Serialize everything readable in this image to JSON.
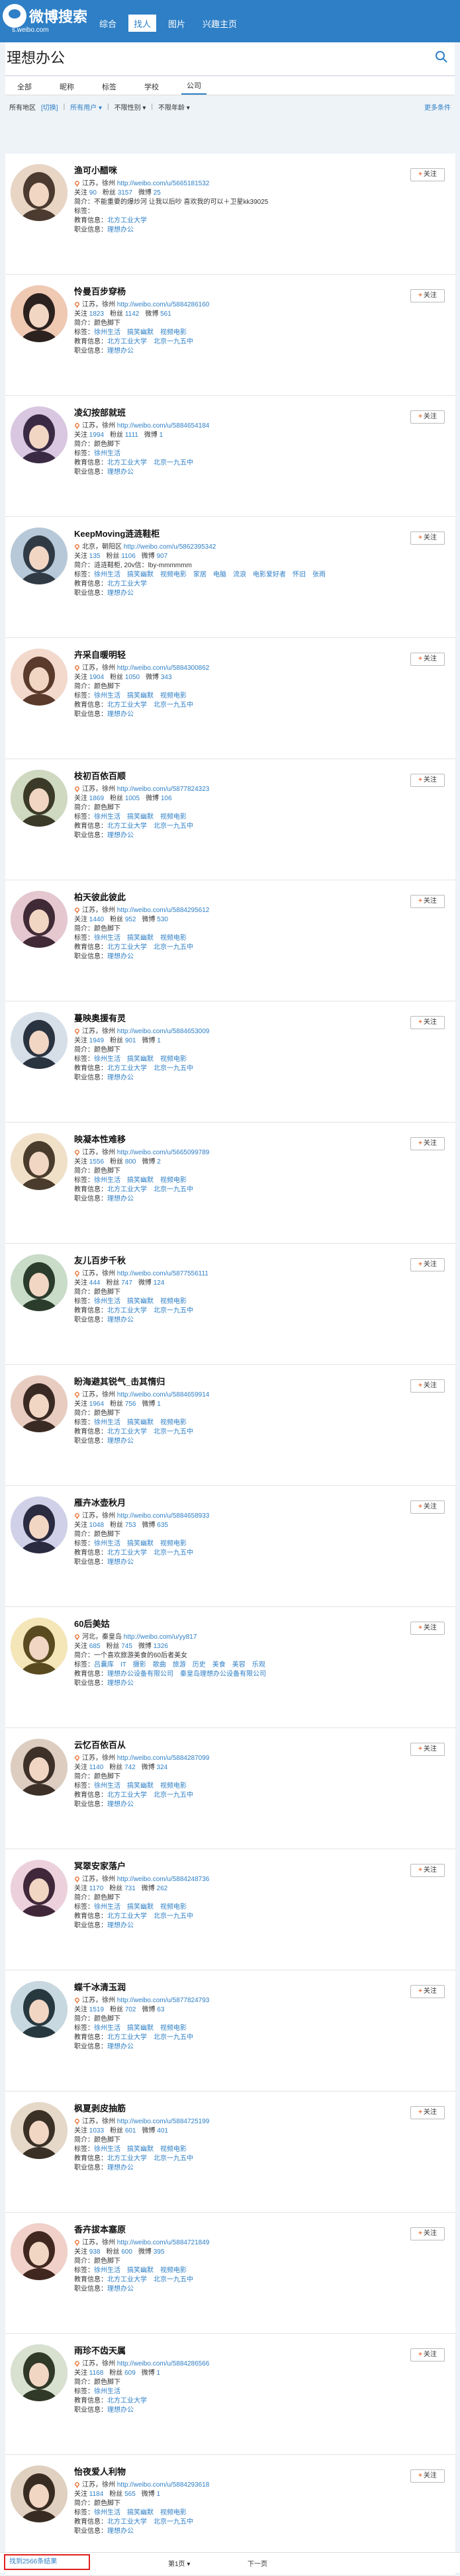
{
  "header": {
    "logo_text": "微博搜索",
    "logo_sub": "s.weibo.com",
    "nav": [
      {
        "label": "综合",
        "active": false
      },
      {
        "label": "找人",
        "active": true
      },
      {
        "label": "图片",
        "active": false
      },
      {
        "label": "兴趣主页",
        "active": false
      }
    ]
  },
  "search": {
    "query": "理想办公"
  },
  "tabs": [
    {
      "label": "全部",
      "active": false
    },
    {
      "label": "昵称",
      "active": false
    },
    {
      "label": "标签",
      "active": false
    },
    {
      "label": "学校",
      "active": false
    },
    {
      "label": "公司",
      "active": true
    }
  ],
  "filter": {
    "region_label": "所有地区",
    "region_link": "[切换]",
    "user_type": "所有用户 ▾",
    "gender": "不限性别 ▾",
    "age": "不限年龄 ▾",
    "more": "更多条件"
  },
  "labels": {
    "follow": "关注",
    "follows": "关注",
    "fans": "粉丝",
    "weibo": "微博",
    "intro": "简介：",
    "tags": "标签：",
    "edu": "教育信息：",
    "job": "职业信息："
  },
  "users": [
    {
      "name": "渔可小醋咪",
      "location": "江苏，徐州",
      "url": "http://weibo.com/u/5665181532",
      "follows": "90",
      "fans": "3157",
      "weibo": "25",
      "intro": "不能重要的爆炒河 让我以后吵 喜欢我的可以＋卫星kk39025",
      "tags": "",
      "edu": "北方工业大学",
      "job": "理想办公"
    },
    {
      "name": "怜曼百步穿杨",
      "location": "江苏，徐州",
      "url": "http://weibo.com/u/5884286160",
      "follows": "1823",
      "fans": "1142",
      "weibo": "561",
      "intro": "颜色脚下",
      "tags": "徐州生活　搞笑幽默　视频电影",
      "edu": "北方工业大学　北京一九五中",
      "job": "理想办公"
    },
    {
      "name": "凌幻按部就班",
      "location": "江苏，徐州",
      "url": "http://weibo.com/u/5884654184",
      "follows": "1994",
      "fans": "1111",
      "weibo": "1",
      "intro": "颜色脚下",
      "tags": "徐州生活",
      "edu": "北方工业大学　北京一九五中",
      "job": "理想办公"
    },
    {
      "name": "KeepMoving涟涟鞋柜",
      "location": "北京，朝阳区",
      "url": "http://weibo.com/u/5862395342",
      "follows": "135",
      "fans": "1106",
      "weibo": "907",
      "intro": "涟涟鞋柜, 20v信：lby-mmmmmm",
      "tags": "徐州生活　搞笑幽默　视频电影　家居　电脑　流浪　电影爱好者　怀旧　张雨",
      "edu": "北方工业大学",
      "job": "理想办公"
    },
    {
      "name": "卉采自暖明轻",
      "location": "江苏，徐州",
      "url": "http://weibo.com/u/5884300862",
      "follows": "1904",
      "fans": "1050",
      "weibo": "343",
      "intro": "颜色脚下",
      "tags": "徐州生活　搞笑幽默　视频电影",
      "edu": "北方工业大学　北京一九五中",
      "job": "理想办公"
    },
    {
      "name": "枝初百依百顺",
      "location": "江苏，徐州",
      "url": "http://weibo.com/u/5877824323",
      "follows": "1869",
      "fans": "1005",
      "weibo": "106",
      "intro": "颜色脚下",
      "tags": "徐州生活　搞笑幽默　视频电影",
      "edu": "北方工业大学　北京一九五中",
      "job": "理想办公"
    },
    {
      "name": "柏天彼此彼此",
      "location": "江苏，徐州",
      "url": "http://weibo.com/u/5884295612",
      "follows": "1440",
      "fans": "952",
      "weibo": "530",
      "intro": "颜色脚下",
      "tags": "徐州生活　搞笑幽默　视频电影",
      "edu": "北方工业大学　北京一九五中",
      "job": "理想办公"
    },
    {
      "name": "蔓映奥援有灵",
      "location": "江苏，徐州",
      "url": "http://weibo.com/u/5884653009",
      "follows": "1949",
      "fans": "901",
      "weibo": "1",
      "intro": "颜色脚下",
      "tags": "徐州生活　搞笑幽默　视频电影",
      "edu": "北方工业大学　北京一九五中",
      "job": "理想办公"
    },
    {
      "name": "映凝本性难移",
      "location": "江苏，徐州",
      "url": "http://weibo.com/u/5665099789",
      "follows": "1556",
      "fans": "800",
      "weibo": "2",
      "intro": "颜色脚下",
      "tags": "徐州生活　搞笑幽默　视频电影",
      "edu": "北方工业大学　北京一九五中",
      "job": "理想办公"
    },
    {
      "name": "友儿百步千秋",
      "location": "江苏，徐州",
      "url": "http://weibo.com/u/5877556111",
      "follows": "444",
      "fans": "747",
      "weibo": "124",
      "intro": "颜色脚下",
      "tags": "徐州生活　搞笑幽默　视频电影",
      "edu": "北方工业大学　北京一九五中",
      "job": "理想办公"
    },
    {
      "name": "盼海避其锐气_击其惰归",
      "location": "江苏，徐州",
      "url": "http://weibo.com/u/5884659914",
      "follows": "1964",
      "fans": "756",
      "weibo": "1",
      "intro": "颜色脚下",
      "tags": "徐州生活　搞笑幽默　视频电影",
      "edu": "北方工业大学　北京一九五中",
      "job": "理想办公"
    },
    {
      "name": "雁卉冰壶秋月",
      "location": "江苏，徐州",
      "url": "http://weibo.com/u/5884658933",
      "follows": "1048",
      "fans": "753",
      "weibo": "635",
      "intro": "颜色脚下",
      "tags": "徐州生活　搞笑幽默　视频电影",
      "edu": "北方工业大学　北京一九五中",
      "job": "理想办公"
    },
    {
      "name": "60后美姑",
      "location": "河北，秦皇岛",
      "url": "http://weibo.com/u/yy817",
      "follows": "685",
      "fans": "745",
      "weibo": "1326",
      "intro": "一个喜欢旅游美食的60后者美女",
      "tags": "吕囊库　IT　摄影　歌曲　旅游　历史　美食　美容　乐观",
      "edu": "理想办公设备有限公司　秦皇岛理想办公设备有限公司",
      "job": "理想办公"
    },
    {
      "name": "云忆百依百从",
      "location": "江苏，徐州",
      "url": "http://weibo.com/u/5884287099",
      "follows": "1140",
      "fans": "742",
      "weibo": "324",
      "intro": "颜色脚下",
      "tags": "徐州生活　搞笑幽默　视频电影",
      "edu": "北方工业大学　北京一九五中",
      "job": "理想办公"
    },
    {
      "name": "冥翠安家落户",
      "location": "江苏，徐州",
      "url": "http://weibo.com/u/5884248736",
      "follows": "1170",
      "fans": "731",
      "weibo": "262",
      "intro": "颜色脚下",
      "tags": "徐州生活　搞笑幽默　视频电影",
      "edu": "北方工业大学　北京一九五中",
      "job": "理想办公"
    },
    {
      "name": "蝶千冰清玉润",
      "location": "江苏，徐州",
      "url": "http://weibo.com/u/5877824793",
      "follows": "1519",
      "fans": "702",
      "weibo": "63",
      "intro": "颜色脚下",
      "tags": "徐州生活　搞笑幽默　视频电影",
      "edu": "北方工业大学　北京一九五中",
      "job": "理想办公"
    },
    {
      "name": "枫夏剥皮抽筋",
      "location": "江苏，徐州",
      "url": "http://weibo.com/u/5884725199",
      "follows": "1033",
      "fans": "601",
      "weibo": "401",
      "intro": "颜色脚下",
      "tags": "徐州生活　搞笑幽默　视频电影",
      "edu": "北方工业大学　北京一九五中",
      "job": "理想办公"
    },
    {
      "name": "香卉拔本塞原",
      "location": "江苏，徐州",
      "url": "http://weibo.com/u/5884721849",
      "follows": "938",
      "fans": "600",
      "weibo": "395",
      "intro": "颜色脚下",
      "tags": "徐州生活　搞笑幽默　视频电影",
      "edu": "北方工业大学　北京一九五中",
      "job": "理想办公"
    },
    {
      "name": "雨珍不齿天属",
      "location": "江苏，徐州",
      "url": "http://weibo.com/u/5884286566",
      "follows": "1168",
      "fans": "609",
      "weibo": "1",
      "intro": "颜色脚下",
      "tags": "徐州生活",
      "edu": "北方工业大学",
      "job": "理想办公"
    },
    {
      "name": "怡夜爱人利物",
      "location": "江苏，徐州",
      "url": "http://weibo.com/u/5884293618",
      "follows": "1184",
      "fans": "565",
      "weibo": "1",
      "intro": "颜色脚下",
      "tags": "徐州生活　搞笑幽默　视频电影",
      "edu": "北方工业大学　北京一九五中",
      "job": "理想办公"
    }
  ],
  "pager": {
    "total": "找到2566条结果",
    "current_page": "第1页 ▾",
    "next": "下一页"
  },
  "colors": {
    "brand": "#2e7fc6",
    "link": "#2e7fc6",
    "highlight_box": "#e02020"
  }
}
